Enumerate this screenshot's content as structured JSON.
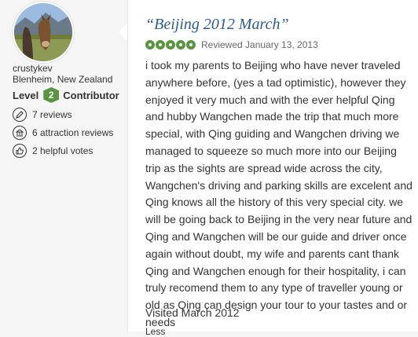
{
  "reviewer": {
    "username": "crustykev",
    "location": "Blenheim, New Zealand",
    "level_prefix": "Level",
    "level_number": "2",
    "level_suffix": "Contributor",
    "reviews": "7 reviews",
    "attraction_reviews": "6 attraction reviews",
    "helpful_votes": "2 helpful votes"
  },
  "review": {
    "title": "“Beijing 2012 March”",
    "rating": 5,
    "rating_max": 5,
    "reviewed_date": "Reviewed January 13, 2013",
    "body": "i took my parents to Beijing who have never traveled anywhere before, (yes a tad optimistic), however they enjoyed it very much and with the ever helpful Qing and hubby Wangchen made the trip that much more special, with Qing guiding and Wangchen driving we managed to squeeze so much more into our Beijing trip as the sights are spread wide across the city, Wangchen's driving and parking skills are excelent and Qing knows all the history of this very special city. we will be going back to Beijing in the very near future and Qing and Wangchen will be our guide and driver once again without doubt, my wife and parents cant thank Qing and Wangchen enough for their hospitality, i can truly recomend them to any type of traveller young or old as Qing can design your tour to your tastes and or needs",
    "visited": "Visited March 2012",
    "less_link": "Less"
  },
  "colors": {
    "accent_green": "#589442",
    "title_blue": "#2b5d8a"
  },
  "icons": {
    "reviews": "pen-icon",
    "attraction_reviews": "landmark-icon",
    "helpful_votes": "thumbs-up-icon"
  }
}
